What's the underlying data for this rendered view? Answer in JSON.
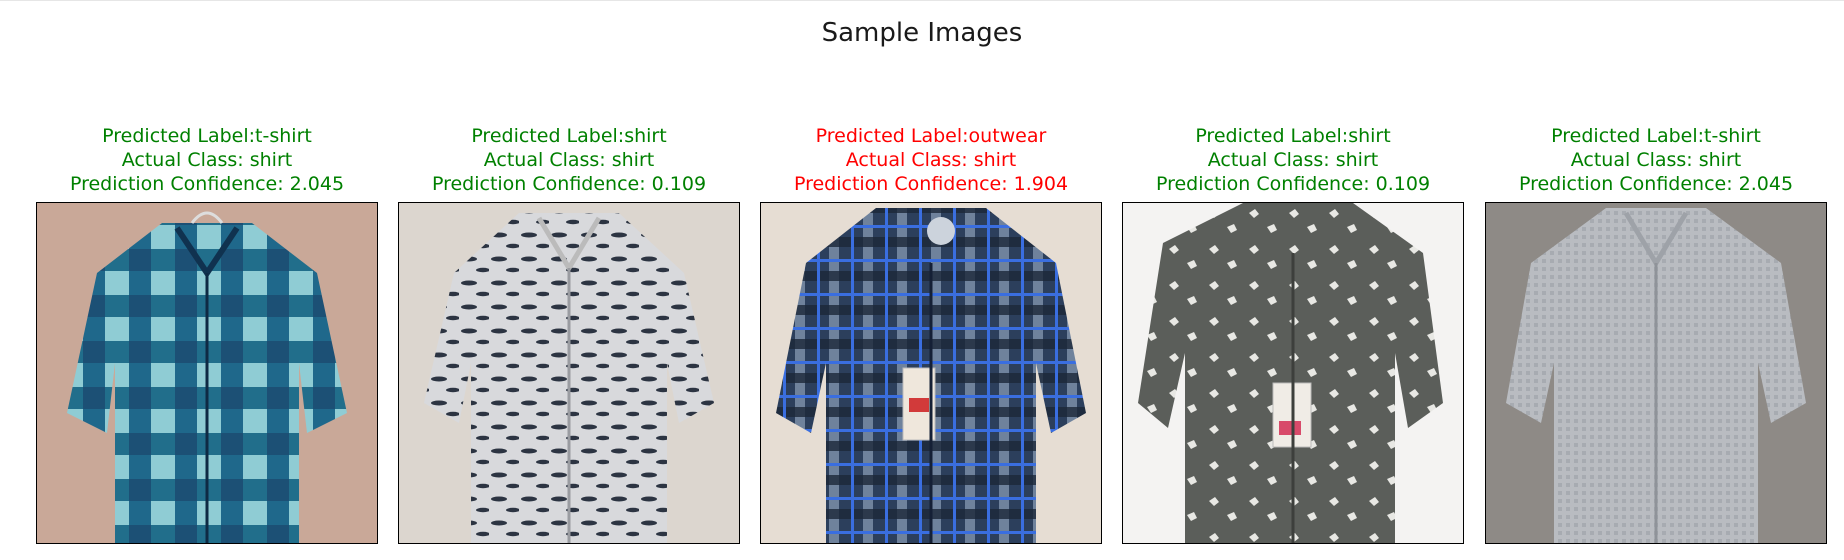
{
  "figure": {
    "title": "Sample Images",
    "colors": {
      "correct": "#008000",
      "incorrect": "#ff0000"
    }
  },
  "samples": [
    {
      "predicted": "Predicted Label:t-shirt",
      "actual": "Actual Class: shirt",
      "confidence": "Prediction Confidence: 2.045",
      "correct": true,
      "image": "teal-navy-plaid-shirt"
    },
    {
      "predicted": "Predicted Label:shirt",
      "actual": "Actual Class: shirt",
      "confidence": "Prediction Confidence: 0.109",
      "correct": true,
      "image": "white-printed-shirt"
    },
    {
      "predicted": "Predicted Label:outwear",
      "actual": "Actual Class: shirt",
      "confidence": "Prediction Confidence: 1.904",
      "correct": false,
      "image": "blue-check-shirt"
    },
    {
      "predicted": "Predicted Label:shirt",
      "actual": "Actual Class: shirt",
      "confidence": "Prediction Confidence: 0.109",
      "correct": true,
      "image": "gray-animal-print-shirt"
    },
    {
      "predicted": "Predicted Label:t-shirt",
      "actual": "Actual Class: shirt",
      "confidence": "Prediction Confidence: 2.045",
      "correct": true,
      "image": "light-gray-shirt"
    }
  ]
}
